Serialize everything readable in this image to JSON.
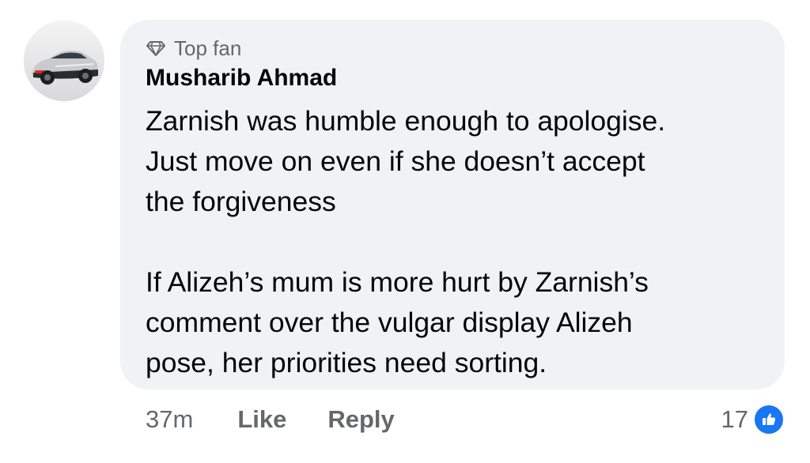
{
  "comment": {
    "badge": "Top fan",
    "badge_icon": "diamond-icon",
    "author": "Musharib Ahmad",
    "avatar_icon": "sports-car-avatar",
    "body_lines": [
      "Zarnish was humble enough to apologise.",
      "Just move on even if she doesn’t accept",
      "the forgiveness",
      "",
      "If Alizeh’s mum is more hurt by Zarnish’s",
      "comment over the vulgar display Alizeh",
      "pose, her priorities need sorting."
    ]
  },
  "actions": {
    "time": "37m",
    "like_label": "Like",
    "reply_label": "Reply"
  },
  "reactions": {
    "count": "17",
    "icon": "thumbs-up-icon",
    "color": "#1877f2"
  },
  "colors": {
    "bubble": "#f0f2f5",
    "secondary_text": "#65676b",
    "primary_text": "#050505"
  }
}
